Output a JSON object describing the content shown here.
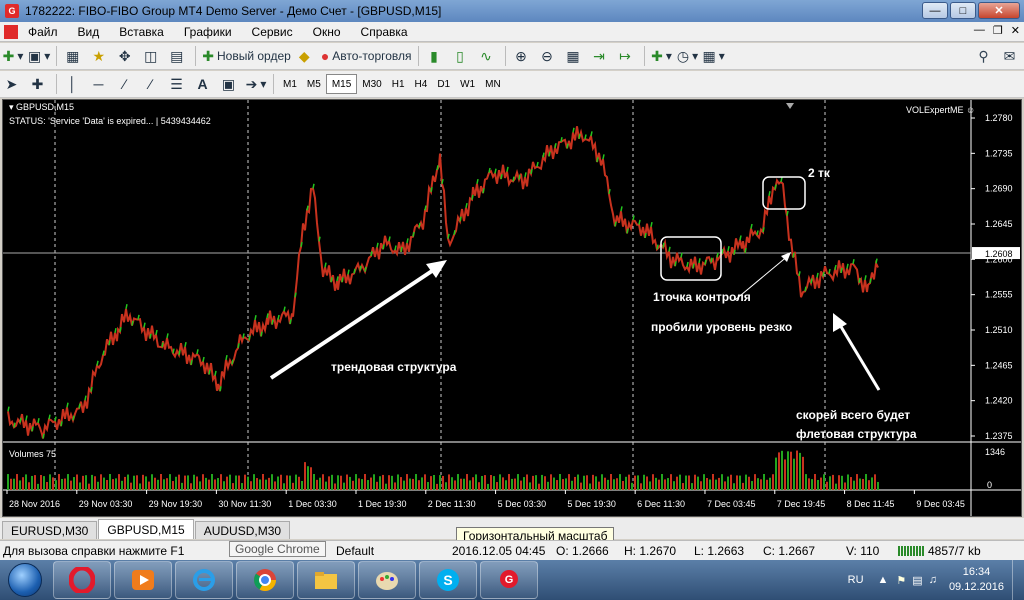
{
  "window": {
    "title": "1782222: FIBO-FIBO Group MT4 Demo Server - Демо Счет - [GBPUSD,M15]",
    "app_icon": "G"
  },
  "menu": [
    "Файл",
    "Вид",
    "Вставка",
    "Графики",
    "Сервис",
    "Окно",
    "Справка"
  ],
  "toolbar": {
    "new_order": "Новый ордер",
    "auto_trading": "Авто-торговля"
  },
  "timeframes": [
    "M1",
    "M5",
    "M15",
    "M30",
    "H1",
    "H4",
    "D1",
    "W1",
    "MN"
  ],
  "active_timeframe": "M15",
  "chart": {
    "symbol_label": "GBPUSD,M15",
    "status_line": "STATUS: 'Service 'Data' is expired... | 5439434462",
    "indicator_name": "VOLExpertME",
    "volumes_label": "Volumes 75",
    "volume_max": "1346",
    "volume_zero": "0",
    "current_price": "1.2608",
    "price_ticks": [
      "1.2780",
      "1.2735",
      "1.2690",
      "1.2645",
      "1.2600",
      "1.2555",
      "1.2510",
      "1.2465",
      "1.2420",
      "1.2375"
    ],
    "time_ticks": [
      "28 Nov 2016",
      "29 Nov 03:30",
      "29 Nov 19:30",
      "30 Nov 11:30",
      "1 Dec 03:30",
      "1 Dec 19:30",
      "2 Dec 11:30",
      "5 Dec 03:30",
      "5 Dec 19:30",
      "6 Dec 11:30",
      "7 Dec 03:45",
      "7 Dec 19:45",
      "8 Dec 11:45",
      "9 Dec 03:45"
    ],
    "annotations": {
      "trend": "трендовая структура",
      "control_point": "1точка контроля",
      "broke_level": "пробили уровень резко",
      "two_tk": "2 тк",
      "flat": "скорей всего будет",
      "flat2": "флетовая структура"
    }
  },
  "tabs": [
    "EURUSD,M30",
    "GBPUSD,M15",
    "AUDUSD,M30"
  ],
  "active_tab": "GBPUSD,M15",
  "tooltip": "Горизонтальный масштаб",
  "status": {
    "help": "Для вызова справки нажмите F1",
    "chrome_tip": "Google Chrome",
    "profile": "Default",
    "datetime": "2016.12.05 04:45",
    "open": "O: 1.2666",
    "high": "H: 1.2670",
    "low": "L: 1.2663",
    "close": "C: 1.2667",
    "volume": "V: 110",
    "traffic": "4857/7 kb"
  },
  "taskbar": {
    "lang": "RU",
    "time": "16:34",
    "date": "09.12.2016"
  }
}
